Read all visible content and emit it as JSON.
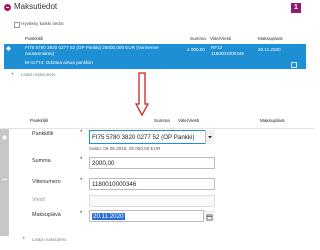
{
  "top": {
    "title": "Maksutiedot",
    "badge": "1",
    "accept_label": "Hyväksy kaikki tiedot",
    "columns": {
      "payee": "Pankkitili",
      "amount": "Summa",
      "ref": "Viite/Viesti",
      "date": "Maksupäivä"
    },
    "row": {
      "account_line1": "FI75 5780 3820 0277 52 (OP Pankki) 25000,000 EUR (Varmenne",
      "account_line2": "noutanmaksu)",
      "message": "M-41774: Odottaa airtua pankkiin",
      "amount": "4 000,00",
      "ref_line1": "RF13",
      "ref_line2": "1180001000346",
      "date": "20.11.2020"
    },
    "add_label": "Lisää maksutieto"
  },
  "bottom": {
    "columns": {
      "payee": "Pankkitili",
      "amount": "Summa",
      "ref": "Viite/Viesti",
      "date": "Maksupäivä"
    },
    "fields": {
      "account_label": "Pankkitili",
      "account_value": "FI75 5780 3820 0277 52 (OP Pankki)",
      "balance_note": "Saldo: 06.06.2019, 25 000,00 EUR",
      "amount_label": "Summa",
      "amount_value": "2000,00",
      "ref_label": "Viitenumero",
      "ref_value": "1180010000346",
      "message_label": "Viesti",
      "message_value": "",
      "date_label": "Maksupäivä",
      "date_value": "20.11.2020"
    },
    "required_mark": "*",
    "add_label": "Lisää maksutieto"
  }
}
